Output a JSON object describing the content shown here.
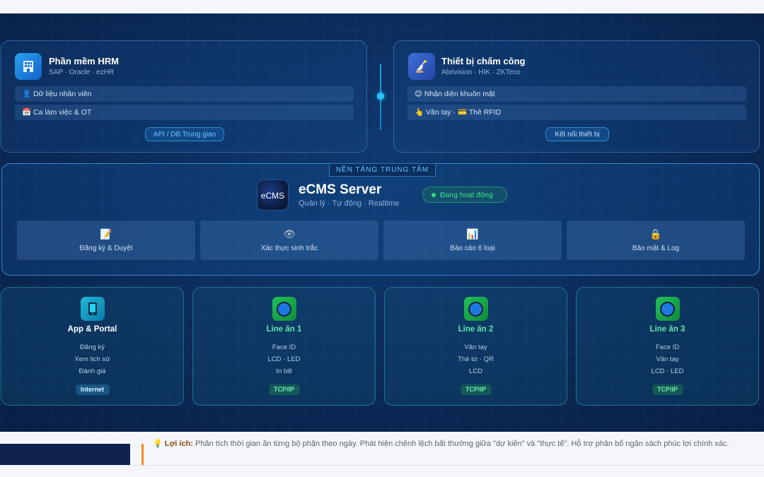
{
  "hrm": {
    "icon": "building-icon",
    "title": "Phần mềm HRM",
    "subtitle": "SAP · Oracle · ezHR",
    "rows": [
      {
        "icon": "👤",
        "label": "Dữ liệu nhân viên"
      },
      {
        "icon": "📅",
        "label": "Ca làm việc & OT"
      }
    ],
    "button": "API / DB Trung gian"
  },
  "device": {
    "icon": "satellite-icon",
    "title": "Thiết bị chấm công",
    "subtitle": "Abrivision · HIK · ZKTeco",
    "rows": [
      {
        "icon": "😊",
        "label": "Nhận diện khuôn mặt"
      },
      {
        "icon": "👆",
        "label": "Vân tay · 💳 Thẻ RFID"
      }
    ],
    "button": "Kết nối thiết bị"
  },
  "core": {
    "tag": "NỀN TẢNG TRUNG TÂM",
    "logo": "eCMS",
    "title": "eCMS Server",
    "subtitle": "Quản lý · Tự động · Realtime",
    "status": "Đang hoạt động",
    "features": [
      {
        "icon": "📝",
        "label": "Đăng ký & Duyệt"
      },
      {
        "icon": "👁",
        "label": "Xác thực sinh trắc"
      },
      {
        "icon": "📊",
        "label": "Báo cáo 6 loại"
      },
      {
        "icon": "🔒",
        "label": "Bảo mật & Log"
      }
    ]
  },
  "outputs": [
    {
      "title": "App & Portal",
      "lines": [
        "Đăng ký",
        "Xem lịch sử",
        "Đánh giá"
      ],
      "badge": "Internet"
    },
    {
      "title": "Line ăn 1",
      "lines": [
        "Face ID",
        "LCD · LED",
        "In bill"
      ],
      "badge": "TCP/IP"
    },
    {
      "title": "Line ăn 2",
      "lines": [
        "Vân tay",
        "Thẻ từ · QR",
        "LCD"
      ],
      "badge": "TCP/IP"
    },
    {
      "title": "Line ăn 3",
      "lines": [
        "Face ID",
        "Vân tay",
        "LCD · LED"
      ],
      "badge": "TCP/IP"
    }
  ],
  "note": {
    "icon": "💡",
    "label": "Lợi ích:",
    "text": "Phân tích thời gian ăn từng bộ phận theo ngày. Phát hiện chênh lệch bất thường giữa \"dự kiến\" và \"thực tế\". Hỗ trợ phân bổ ngân sách phúc lợi chính xác."
  }
}
